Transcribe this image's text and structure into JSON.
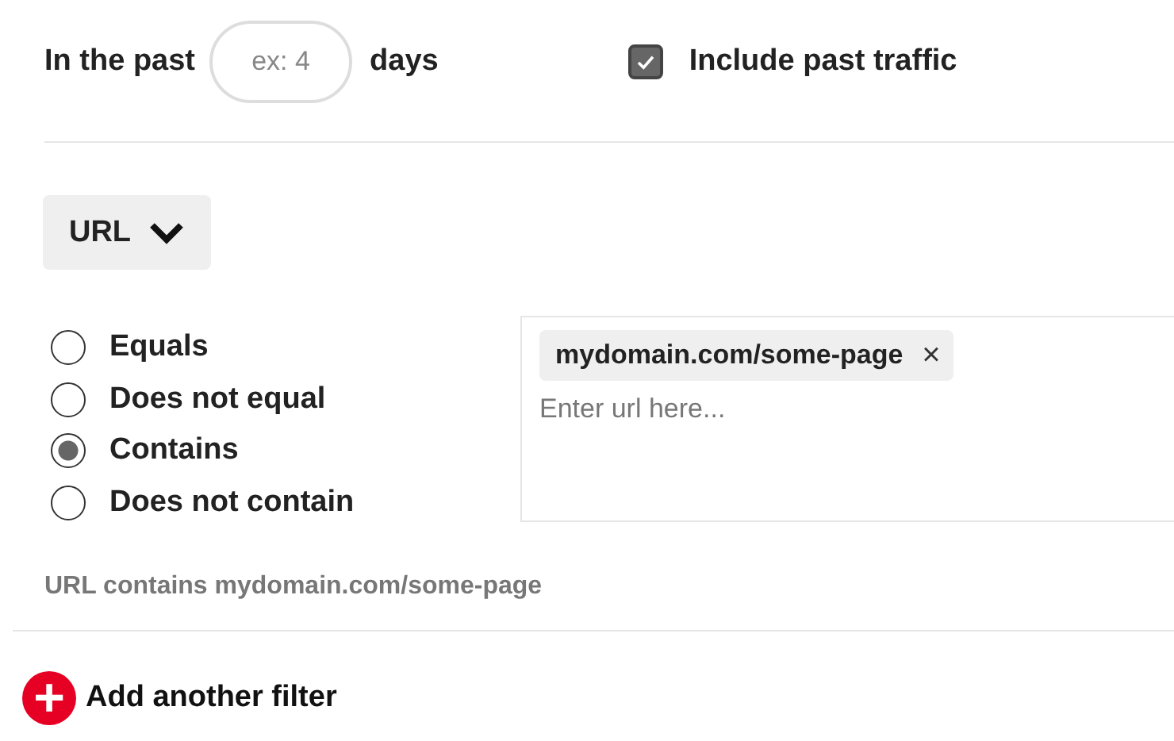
{
  "period": {
    "prefix": "In the past",
    "placeholder": "ex: 4",
    "suffix": "days"
  },
  "include_past_traffic": {
    "label": "Include past traffic",
    "checked": true
  },
  "field_dropdown": {
    "label": "URL",
    "expanded": false
  },
  "match_options": [
    {
      "label": "Equals",
      "selected": false
    },
    {
      "label": "Does not equal",
      "selected": false
    },
    {
      "label": "Contains",
      "selected": true
    },
    {
      "label": "Does not contain",
      "selected": false
    }
  ],
  "url_input": {
    "tags": [
      {
        "label": "mydomain.com/some-page",
        "remove": "×"
      }
    ],
    "placeholder": "Enter url here..."
  },
  "summary": "URL contains mydomain.com/some-page",
  "add_filter": {
    "icon": "+",
    "label": "Add another filter"
  }
}
